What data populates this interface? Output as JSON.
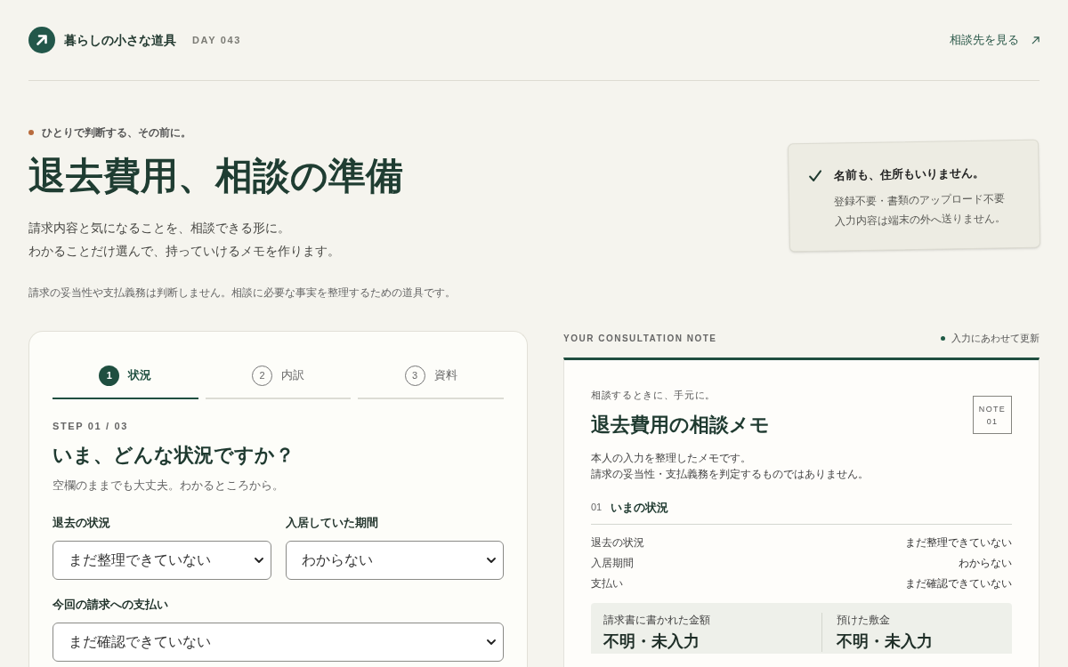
{
  "header": {
    "brand": "暮らしの小さな道具",
    "day": "DAY 043",
    "link": "相談先を見る"
  },
  "hero": {
    "eyebrow": "ひとりで判断する、その前に。",
    "title": "退去費用、相談の準備",
    "lead": [
      "請求内容と気になることを、相談できる形に。",
      "わかることだけ選んで、持っていけるメモを作ります。"
    ],
    "note": "請求の妥当性や支払義務は判断しません。相談に必要な事実を整理するための道具です。"
  },
  "privacy_card": {
    "title": "名前も、住所もいりません。",
    "lines": [
      "登録不要・書類のアップロード不要",
      "入力内容は端末の外へ送りません。"
    ]
  },
  "steps": [
    {
      "number": "1",
      "label": "状況",
      "selected": true
    },
    {
      "number": "2",
      "label": "内訳",
      "selected": false
    },
    {
      "number": "3",
      "label": "資料",
      "selected": false
    }
  ],
  "form": {
    "step": "STEP 01 / 03",
    "question": "いま、どんな状況ですか？",
    "hint": "空欄のままでも大丈夫。わかるところから。",
    "fields": [
      {
        "label": "退去の状況",
        "value": "まだ整理できていない"
      },
      {
        "label": "入居していた期間",
        "value": "わからない"
      },
      {
        "label": "今回の請求への支払い",
        "value": "まだ確認できていない"
      }
    ]
  },
  "note": {
    "heading": "YOUR CONSULTATION NOTE",
    "status": "入力にあわせて更新",
    "eyebrow": "相談するときに、手元に。",
    "title": "退去費用の相談メモ",
    "tag": [
      "NOTE",
      "01"
    ],
    "description": [
      "本人の入力を整理したメモです。",
      "請求の妥当性・支払義務を判定するものではありません。"
    ],
    "section": {
      "number": "01",
      "title": "いまの状況",
      "rows": [
        {
          "label": "退去の状況",
          "value": "まだ整理できていない"
        },
        {
          "label": "入居期間",
          "value": "わからない"
        },
        {
          "label": "支払い",
          "value": "まだ確認できていない"
        }
      ]
    },
    "amounts": [
      {
        "label": "請求書に書かれた金額",
        "value": "不明・未入力"
      },
      {
        "label": "預けた敷金",
        "value": "不明・未入力"
      }
    ]
  }
}
